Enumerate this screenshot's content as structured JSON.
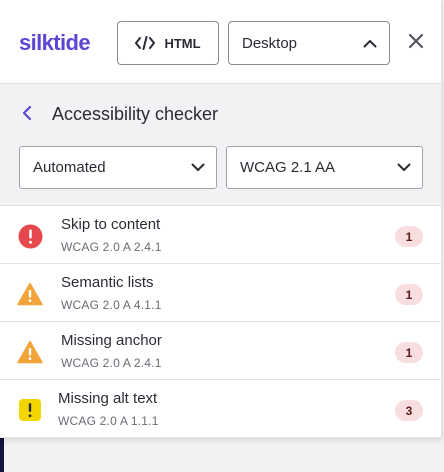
{
  "header": {
    "logo_text": "silktide",
    "html_button_label": "HTML",
    "device_select_value": "Desktop"
  },
  "subheader": {
    "title": "Accessibility checker",
    "filter_mode": "Automated",
    "filter_standard": "WCAG 2.1 AA"
  },
  "issues": [
    {
      "title": "Skip to content",
      "criterion": "WCAG 2.0 A 2.4.1",
      "count": "1",
      "severity": "error",
      "icon": "error-circle-icon"
    },
    {
      "title": "Semantic lists",
      "criterion": "WCAG 2.0 A 4.1.1",
      "count": "1",
      "severity": "warning",
      "icon": "warning-triangle-icon"
    },
    {
      "title": "Missing anchor",
      "criterion": "WCAG 2.0 A 2.4.1",
      "count": "1",
      "severity": "warning",
      "icon": "warning-triangle-icon"
    },
    {
      "title": "Missing alt text",
      "criterion": "WCAG 2.0 A 1.1.1",
      "count": "3",
      "severity": "notice",
      "icon": "alert-square-icon"
    }
  ],
  "colors": {
    "brand": "#5b47d1",
    "error": "#e5484d",
    "warning": "#f0a43a",
    "notice": "#f2d600",
    "count_badge_bg": "#f8dede"
  }
}
